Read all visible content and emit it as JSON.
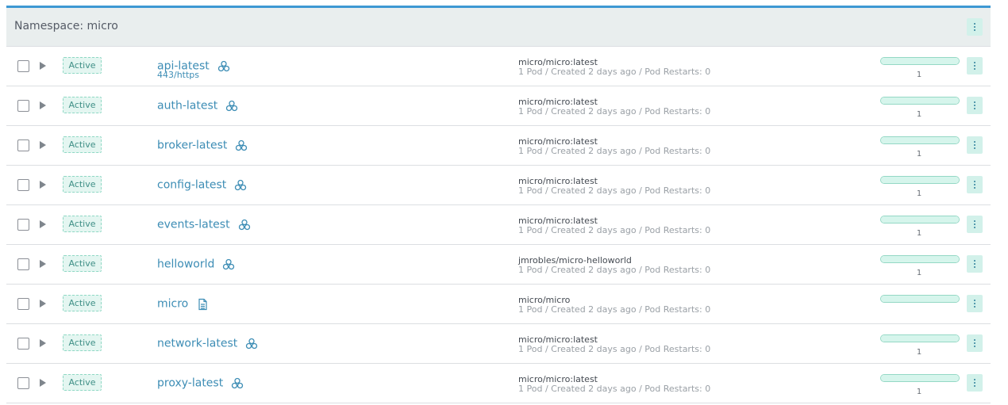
{
  "namespace": {
    "title": "Namespace: micro"
  },
  "rows": [
    {
      "status": "Active",
      "name": "api-latest",
      "icon": "workload-icon",
      "endpoint": "443/https",
      "image": "micro/micro:latest",
      "meta": "1 Pod / Created 2 days ago / Pod Restarts: 0",
      "scale": "1",
      "progress": 1.0
    },
    {
      "status": "Active",
      "name": "auth-latest",
      "icon": "workload-icon",
      "endpoint": "",
      "image": "micro/micro:latest",
      "meta": "1 Pod / Created 2 days ago / Pod Restarts: 0",
      "scale": "1",
      "progress": 1.0
    },
    {
      "status": "Active",
      "name": "broker-latest",
      "icon": "workload-icon",
      "endpoint": "",
      "image": "micro/micro:latest",
      "meta": "1 Pod / Created 2 days ago / Pod Restarts: 0",
      "scale": "1",
      "progress": 1.0
    },
    {
      "status": "Active",
      "name": "config-latest",
      "icon": "workload-icon",
      "endpoint": "",
      "image": "micro/micro:latest",
      "meta": "1 Pod / Created 2 days ago / Pod Restarts: 0",
      "scale": "1",
      "progress": 1.0
    },
    {
      "status": "Active",
      "name": "events-latest",
      "icon": "workload-icon",
      "endpoint": "",
      "image": "micro/micro:latest",
      "meta": "1 Pod / Created 2 days ago / Pod Restarts: 0",
      "scale": "1",
      "progress": 1.0
    },
    {
      "status": "Active",
      "name": "helloworld",
      "icon": "workload-icon",
      "endpoint": "",
      "image": "jmrobles/micro-helloworld",
      "meta": "1 Pod / Created 2 days ago / Pod Restarts: 0",
      "scale": "1",
      "progress": 1.0
    },
    {
      "status": "Active",
      "name": "micro",
      "icon": "document-icon",
      "endpoint": "",
      "image": "micro/micro",
      "meta": "1 Pod / Created 2 days ago / Pod Restarts: 0",
      "scale": "",
      "progress": 1.0
    },
    {
      "status": "Active",
      "name": "network-latest",
      "icon": "workload-icon",
      "endpoint": "",
      "image": "micro/micro:latest",
      "meta": "1 Pod / Created 2 days ago / Pod Restarts: 0",
      "scale": "1",
      "progress": 1.0
    },
    {
      "status": "Active",
      "name": "proxy-latest",
      "icon": "workload-icon",
      "endpoint": "",
      "image": "micro/micro:latest",
      "meta": "1 Pod / Created 2 days ago / Pod Restarts: 0",
      "scale": "1",
      "progress": 1.0
    }
  ],
  "colors": {
    "accent": "#3d98d3",
    "link": "#3d8db5",
    "active_badge_bg": "#e4f6f1",
    "progress": "#d6f5ec"
  }
}
